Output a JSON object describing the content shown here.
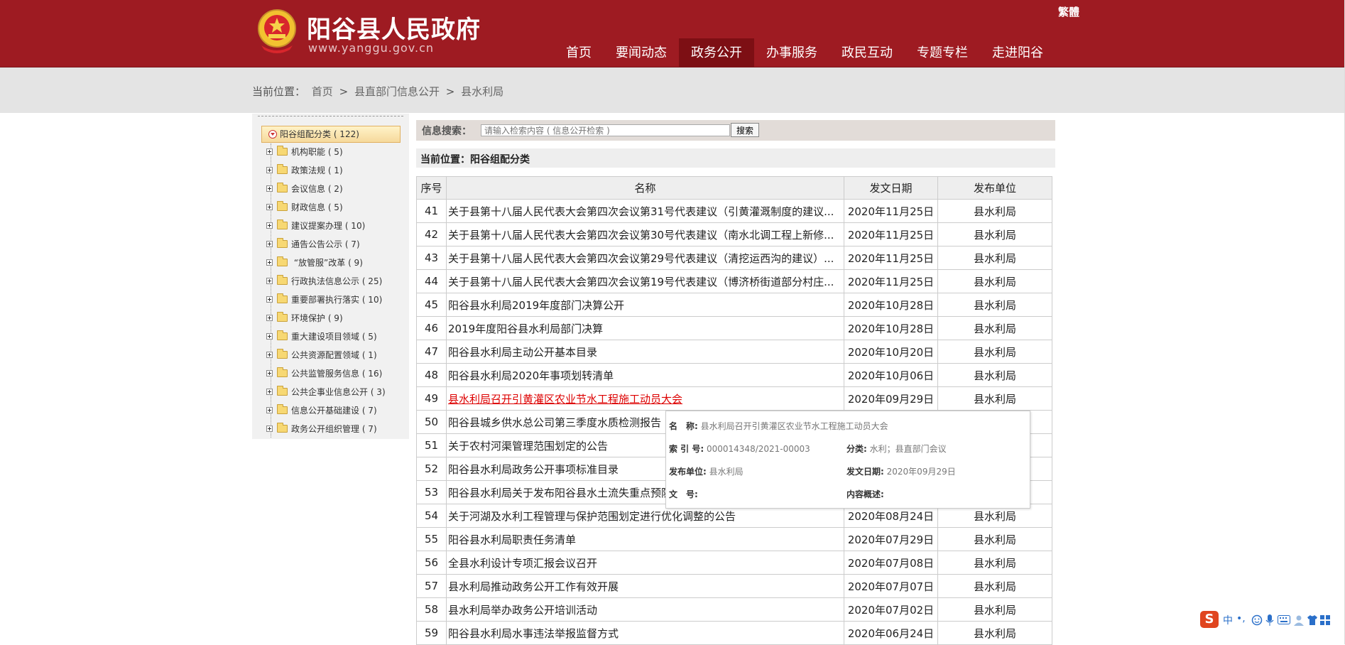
{
  "header": {
    "site_title": "阳谷县人民政府",
    "site_url": "www.yanggu.gov.cn",
    "traditional_link": "繁體",
    "nav": [
      "首页",
      "要闻动态",
      "政务公开",
      "办事服务",
      "政民互动",
      "专题专栏",
      "走进阳谷"
    ],
    "nav_active": "政务公开"
  },
  "breadcrumb": {
    "label": "当前位置：",
    "items": [
      "首页",
      "县直部门信息公开",
      "县水利局"
    ],
    "separator": ">"
  },
  "sidebar": {
    "root": "阳谷组配分类 ( 122)",
    "items": [
      "机构职能 ( 5)",
      "政策法规 ( 1)",
      "会议信息 ( 2)",
      "财政信息 ( 5)",
      "建议提案办理 ( 10)",
      "通告公告公示 ( 7)",
      " “放管服”改革 ( 9)",
      "行政执法信息公示 ( 25)",
      "重要部署执行落实 ( 10)",
      "环境保护 ( 9)",
      "重大建设项目领域 ( 5)",
      "公共资源配置领域 ( 1)",
      "公共监管服务信息 ( 16)",
      "公共企事业信息公开 ( 3)",
      "信息公开基础建设 ( 7)",
      "政务公开组织管理 ( 7)"
    ]
  },
  "search": {
    "label": "信息搜索：",
    "placeholder": "请输入检索内容 ( 信息公开检索 )",
    "button": "搜索"
  },
  "current": {
    "label": "当前位置：阳谷组配分类"
  },
  "table": {
    "headers": [
      "序号",
      "名称",
      "发文日期",
      "发布单位"
    ],
    "rows": [
      {
        "no": "41",
        "title": "关于县第十八届人民代表大会第四次会议第31号代表建议（引黄灌溉制度的建议...",
        "date": "2020年11月25日",
        "unit": "县水利局"
      },
      {
        "no": "42",
        "title": "关于县第十八届人民代表大会第四次会议第30号代表建议（南水北调工程上新修...",
        "date": "2020年11月25日",
        "unit": "县水利局"
      },
      {
        "no": "43",
        "title": "关于县第十八届人民代表大会第四次会议第29号代表建议（清挖运西沟的建议）...",
        "date": "2020年11月25日",
        "unit": "县水利局"
      },
      {
        "no": "44",
        "title": "关于县第十八届人民代表大会第四次会议第19号代表建议（博济桥街道部分村庄...",
        "date": "2020年11月25日",
        "unit": "县水利局"
      },
      {
        "no": "45",
        "title": "阳谷县水利局2019年度部门决算公开",
        "date": "2020年10月28日",
        "unit": "县水利局"
      },
      {
        "no": "46",
        "title": "2019年度阳谷县水利局部门决算",
        "date": "2020年10月28日",
        "unit": "县水利局"
      },
      {
        "no": "47",
        "title": "阳谷县水利局主动公开基本目录",
        "date": "2020年10月20日",
        "unit": "县水利局"
      },
      {
        "no": "48",
        "title": "阳谷县水利局2020年事项划转清单",
        "date": "2020年10月06日",
        "unit": "县水利局"
      },
      {
        "no": "49",
        "title": "县水利局召开引黄灌区农业节水工程施工动员大会",
        "date": "2020年09月29日",
        "unit": "县水利局"
      },
      {
        "no": "50",
        "title": "阳谷县城乡供水总公司第三季度水质检测报告",
        "date": "",
        "unit": ""
      },
      {
        "no": "51",
        "title": "关于农村河渠管理范围划定的公告",
        "date": "",
        "unit": ""
      },
      {
        "no": "52",
        "title": "阳谷县水利局政务公开事项标准目录",
        "date": "",
        "unit": ""
      },
      {
        "no": "53",
        "title": "阳谷县水利局关于发布阳谷县水土流失重点预防",
        "date": "",
        "unit": ""
      },
      {
        "no": "54",
        "title": "关于河湖及水利工程管理与保护范围划定进行优化调整的公告",
        "date": "2020年08月24日",
        "unit": "县水利局"
      },
      {
        "no": "55",
        "title": "阳谷县水利局职责任务清单",
        "date": "2020年07月29日",
        "unit": "县水利局"
      },
      {
        "no": "56",
        "title": "全县水利设计专项汇报会议召开",
        "date": "2020年07月08日",
        "unit": "县水利局"
      },
      {
        "no": "57",
        "title": "县水利局推动政务公开工作有效开展",
        "date": "2020年07月07日",
        "unit": "县水利局"
      },
      {
        "no": "58",
        "title": "县水利局举办政务公开培训活动",
        "date": "2020年07月02日",
        "unit": "县水利局"
      },
      {
        "no": "59",
        "title": "阳谷县水利局水事违法举报监督方式",
        "date": "2020年06月24日",
        "unit": "县水利局"
      }
    ]
  },
  "tooltip": {
    "name_label": "名　称:",
    "name_value": "县水利局召开引黄灌区农业节水工程施工动员大会",
    "index_label": "索 引 号:",
    "index_value": "000014348/2021-00003",
    "category_label": "分类:",
    "category_value": "水利；县直部门会议",
    "publisher_label": "发布单位:",
    "publisher_value": "县水利局",
    "date_label": "发文日期:",
    "date_value": "2020年09月29日",
    "doc_no_label": "文　号:",
    "summary_label": "内容概述:"
  },
  "ime": {
    "logo": "S",
    "mode": "中",
    "punct": "•,"
  },
  "colors": {
    "header_bg": "#9e1b22",
    "nav_active_bg": "#7d0f14",
    "link_highlight": "#dd0000"
  }
}
